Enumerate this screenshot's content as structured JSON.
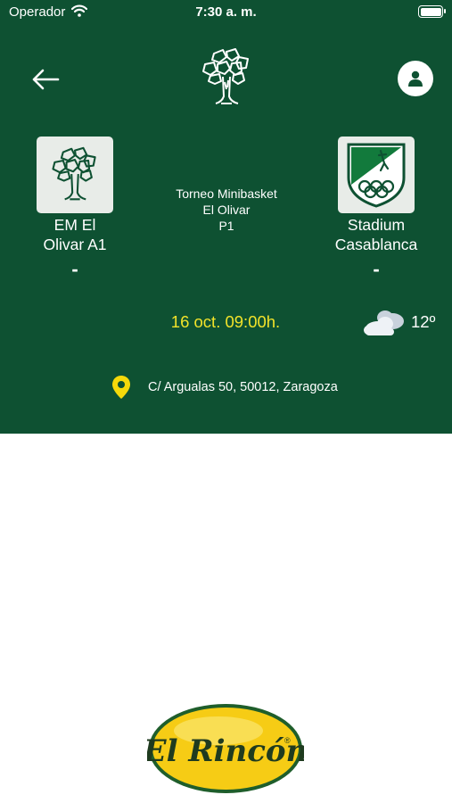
{
  "status_bar": {
    "carrier": "Operador",
    "time": "7:30 a. m."
  },
  "match": {
    "home": {
      "name_line1": "EM El",
      "name_line2": "Olivar A1",
      "score": "-"
    },
    "away": {
      "name_line1": "Stadium",
      "name_line2": "Casablanca",
      "score": "-"
    },
    "competition": {
      "line1": "Torneo Minibasket",
      "line2": "El Olivar",
      "line3": "P1"
    },
    "datetime": "16 oct. 09:00h.",
    "temperature": "12º",
    "address": "C/ Argualas 50, 50012, Zaragoza"
  },
  "sponsor": {
    "text": "El Rincón",
    "mark": "®"
  },
  "colors": {
    "header_bg": "#0e5132",
    "date_text": "#f2e32a",
    "pin": "#f5d90a",
    "sponsor_yellow": "#f6cc15",
    "sponsor_green": "#1f5e2b"
  },
  "icons": {
    "back": "arrow-left-icon",
    "profile": "person-icon",
    "weather": "cloudy-icon",
    "location": "map-pin-icon"
  }
}
